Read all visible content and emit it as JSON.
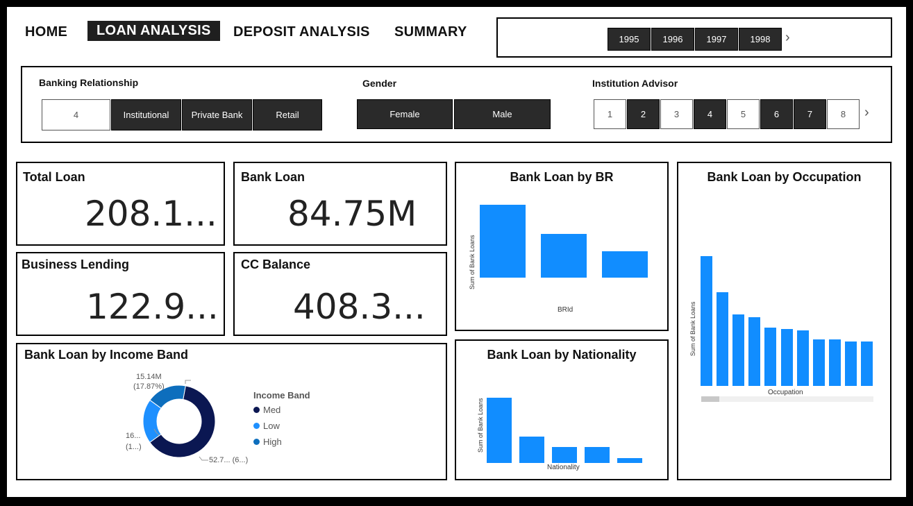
{
  "nav": {
    "home": "HOME",
    "loan": "LOAN ANALYSIS",
    "deposit": "DEPOSIT ANALYSIS",
    "summary": "SUMMARY"
  },
  "years": [
    "1995",
    "1996",
    "1997",
    "1998"
  ],
  "filters": {
    "br_label": "Banking Relationship",
    "br_options": [
      "4",
      "Institutional",
      "Private Bank",
      "Retail"
    ],
    "gender_label": "Gender",
    "gender_options": [
      "Female",
      "Male"
    ],
    "advisor_label": "Institution Advisor",
    "advisor_options": [
      "1",
      "2",
      "3",
      "4",
      "5",
      "6",
      "7",
      "8"
    ]
  },
  "kpis": {
    "total_loan": {
      "title": "Total Loan",
      "value": "208.1..."
    },
    "bank_loan": {
      "title": "Bank Loan",
      "value": "84.75M"
    },
    "business_lending": {
      "title": "Business Lending",
      "value": "122.9..."
    },
    "cc_balance": {
      "title": "CC Balance",
      "value": "408.3..."
    }
  },
  "colors": {
    "bar": "#118dff",
    "med": "#0b1752",
    "low": "#1e90ff",
    "high": "#0d6ebd"
  },
  "chart_data": [
    {
      "type": "bar",
      "title": "Bank Loan by BR",
      "xlabel": "BRId",
      "ylabel": "Sum of Bank Loans",
      "values": [
        100,
        60,
        36
      ]
    },
    {
      "type": "bar",
      "title": "Bank Loan by Nationality",
      "xlabel": "Nationality",
      "ylabel": "Sum of Bank Loans",
      "values": [
        100,
        40,
        24,
        24,
        7
      ]
    },
    {
      "type": "bar",
      "title": "Bank Loan by Occupation",
      "xlabel": "Occupation",
      "ylabel": "Sum of Bank Loans",
      "values": [
        100,
        72,
        55,
        53,
        45,
        44,
        43,
        36,
        36,
        34,
        34
      ]
    },
    {
      "type": "pie",
      "title": "Bank Loan by Income Band",
      "legend_title": "Income Band",
      "slices": [
        {
          "name": "Med",
          "pct": 62.2,
          "label": "52.7... (6...)"
        },
        {
          "name": "Low",
          "pct": 19.9,
          "label1": "16...",
          "label2": "(1...)"
        },
        {
          "name": "High",
          "pct": 17.87,
          "label1": "15.14M",
          "label2": "(17.87%)"
        }
      ]
    }
  ]
}
